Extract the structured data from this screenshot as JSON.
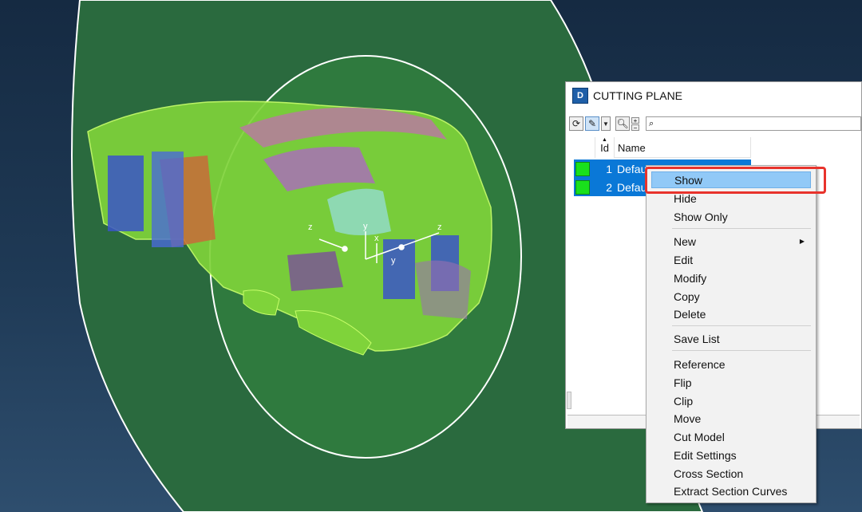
{
  "window": {
    "title": "CUTTING PLANE",
    "app_icon": "cutting-plane-app-icon"
  },
  "toolbar": {
    "icons": [
      "refresh-icon",
      "highlighter-icon",
      "dropdown-arrow-icon",
      "zoom-icon",
      "expand-icon",
      "collapse-icon",
      "search-icon"
    ],
    "search_placeholder": ""
  },
  "list": {
    "columns": [
      "Id",
      "Name"
    ],
    "rows": [
      {
        "id": "1",
        "name": "Default TY Section Plane",
        "color": "#19e01c"
      },
      {
        "id": "2",
        "name": "Default",
        "color": "#19e01c"
      }
    ]
  },
  "context_menu": {
    "items": [
      "Show",
      "Hide",
      "Show Only",
      "New",
      "Edit",
      "Modify",
      "Copy",
      "Delete",
      "Save List",
      "Reference",
      "Flip",
      "Clip",
      "Move",
      "Cut Model",
      "Edit Settings",
      "Cross Section",
      "Extract Section Curves"
    ],
    "highlighted": "Show",
    "submenu_item": "New"
  },
  "viewport": {
    "axis_labels": [
      "z",
      "y",
      "x",
      "z",
      "y",
      "x",
      "y",
      "x",
      "z",
      "y"
    ],
    "colors": {
      "background": "#1f3a56",
      "plane": "#2f7a3e",
      "model": "#7fd33a",
      "annotation": "#e8332c"
    }
  }
}
